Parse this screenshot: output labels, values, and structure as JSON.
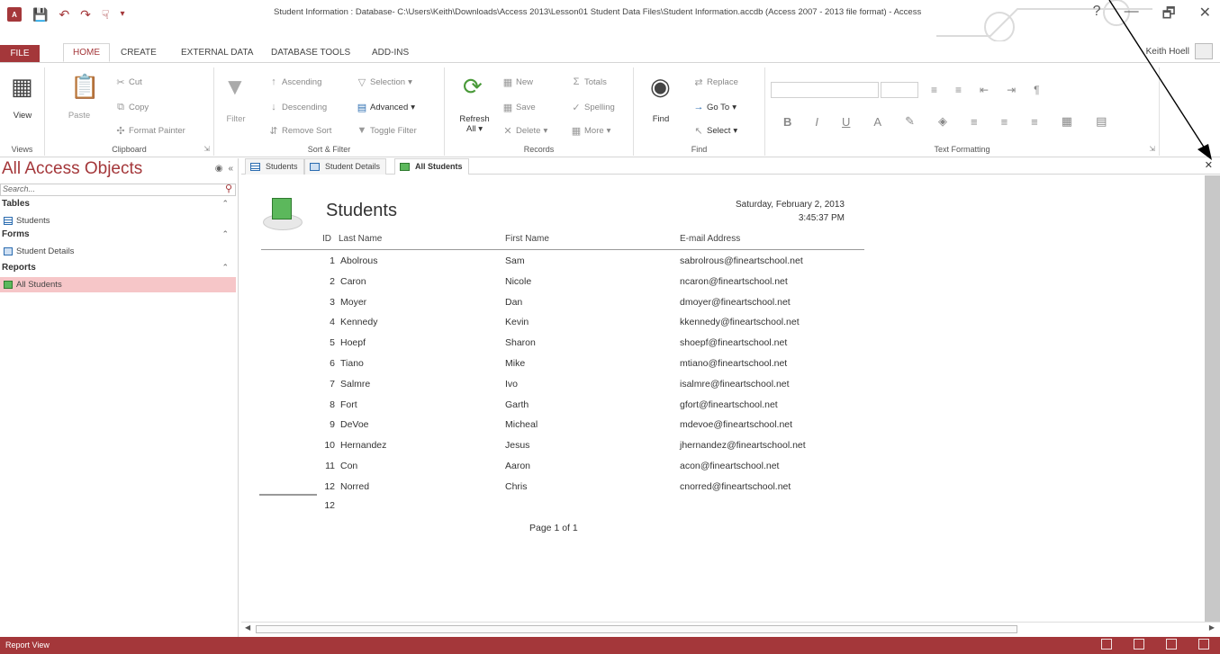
{
  "window": {
    "title": "Student Information : Database- C:\\Users\\Keith\\Downloads\\Access 2013\\Lesson01 Student Data Files\\Student Information.accdb (Access 2007 - 2013 file format) - Access",
    "help": "?",
    "minimize": "—",
    "restore": "🗗",
    "close": "✕"
  },
  "ribbon_tabs": [
    "FILE",
    "HOME",
    "CREATE",
    "EXTERNAL DATA",
    "DATABASE TOOLS",
    "ADD-INS"
  ],
  "user": "Keith Hoell",
  "ribbon": {
    "views": {
      "view": "View",
      "label": "Views"
    },
    "clipboard": {
      "paste": "Paste",
      "cut": "Cut",
      "copy": "Copy",
      "format_painter": "Format Painter",
      "label": "Clipboard"
    },
    "sort_filter": {
      "filter": "Filter",
      "ascending": "Ascending",
      "descending": "Descending",
      "remove_sort": "Remove Sort",
      "selection": "Selection",
      "advanced": "Advanced",
      "toggle_filter": "Toggle Filter",
      "label": "Sort & Filter"
    },
    "records": {
      "refresh": "Refresh",
      "refresh_all": "All",
      "new": "New",
      "save": "Save",
      "delete": "Delete",
      "totals": "Totals",
      "spelling": "Spelling",
      "more": "More",
      "label": "Records"
    },
    "find": {
      "find": "Find",
      "replace": "Replace",
      "goto": "Go To",
      "select": "Select",
      "label": "Find"
    },
    "text_formatting": {
      "bold": "B",
      "italic": "I",
      "underline": "U",
      "font_color": "A",
      "label": "Text Formatting"
    }
  },
  "nav": {
    "title": "All Access Objects",
    "search_placeholder": "Search...",
    "sections": [
      {
        "name": "Tables",
        "items": [
          "Students"
        ]
      },
      {
        "name": "Forms",
        "items": [
          "Student Details"
        ]
      },
      {
        "name": "Reports",
        "items": [
          "All Students"
        ]
      }
    ]
  },
  "doc_tabs": [
    "Students",
    "Student Details",
    "All Students"
  ],
  "report": {
    "title": "Students",
    "date": "Saturday, February 2, 2013",
    "time": "3:45:37 PM",
    "headers": {
      "id": "ID",
      "last": "Last Name",
      "first": "First Name",
      "email": "E-mail Address"
    },
    "rows": [
      {
        "id": "1",
        "last": "Abolrous",
        "first": "Sam",
        "email": "sabrolrous@fineartschool.net"
      },
      {
        "id": "2",
        "last": "Caron",
        "first": "Nicole",
        "email": "ncaron@fineartschool.net"
      },
      {
        "id": "3",
        "last": "Moyer",
        "first": "Dan",
        "email": "dmoyer@fineartschool.net"
      },
      {
        "id": "4",
        "last": "Kennedy",
        "first": "Kevin",
        "email": "kkennedy@fineartschool.net"
      },
      {
        "id": "5",
        "last": "Hoepf",
        "first": "Sharon",
        "email": "shoepf@fineartschool.net"
      },
      {
        "id": "6",
        "last": "Tiano",
        "first": "Mike",
        "email": "mtiano@fineartschool.net"
      },
      {
        "id": "7",
        "last": "Salmre",
        "first": "Ivo",
        "email": "isalmre@fineartschool.net"
      },
      {
        "id": "8",
        "last": "Fort",
        "first": "Garth",
        "email": "gfort@fineartschool.net"
      },
      {
        "id": "9",
        "last": "DeVoe",
        "first": "Micheal",
        "email": "mdevoe@fineartschool.net"
      },
      {
        "id": "10",
        "last": "Hernandez",
        "first": "Jesus",
        "email": "jhernandez@fineartschool.net"
      },
      {
        "id": "11",
        "last": "Con",
        "first": "Aaron",
        "email": "acon@fineartschool.net"
      },
      {
        "id": "12",
        "last": "Norred",
        "first": "Chris",
        "email": "cnorred@fineartschool.net"
      }
    ],
    "count": "12",
    "page": "Page 1 of 1"
  },
  "status": {
    "text": "Report View"
  },
  "colors": {
    "accent": "#a4373a",
    "selected_nav": "#f6c6c8"
  }
}
